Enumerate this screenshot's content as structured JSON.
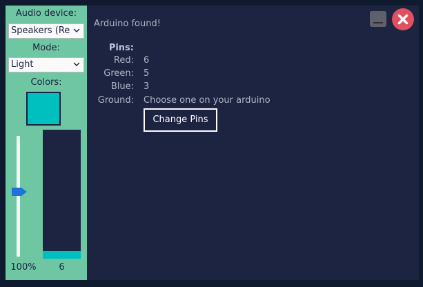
{
  "sidebar": {
    "audio_device_label": "Audio device:",
    "audio_device_value": "Speakers (Re",
    "mode_label": "Mode:",
    "mode_value": "Light",
    "colors_label": "Colors:",
    "swatch_color": "#00bfbf",
    "volume_percent": 0.54,
    "volume_label": "100%",
    "meter_level": 0.06,
    "meter_label": "6"
  },
  "main": {
    "status": "Arduino found!",
    "pins_heading": "Pins:",
    "pins": [
      {
        "label": "Red:",
        "value": "6"
      },
      {
        "label": "Green:",
        "value": "5"
      },
      {
        "label": "Blue:",
        "value": "3"
      },
      {
        "label": "Ground:",
        "value": "Choose one on your arduino"
      }
    ],
    "change_pins_label": "Change Pins"
  },
  "icons": {
    "minimize": "minimize-icon",
    "close": "close-icon"
  },
  "colors": {
    "sidebar_bg": "#6fc6a3",
    "main_bg": "#1d2442",
    "accent": "#00bfbf",
    "close": "#e0505e"
  }
}
